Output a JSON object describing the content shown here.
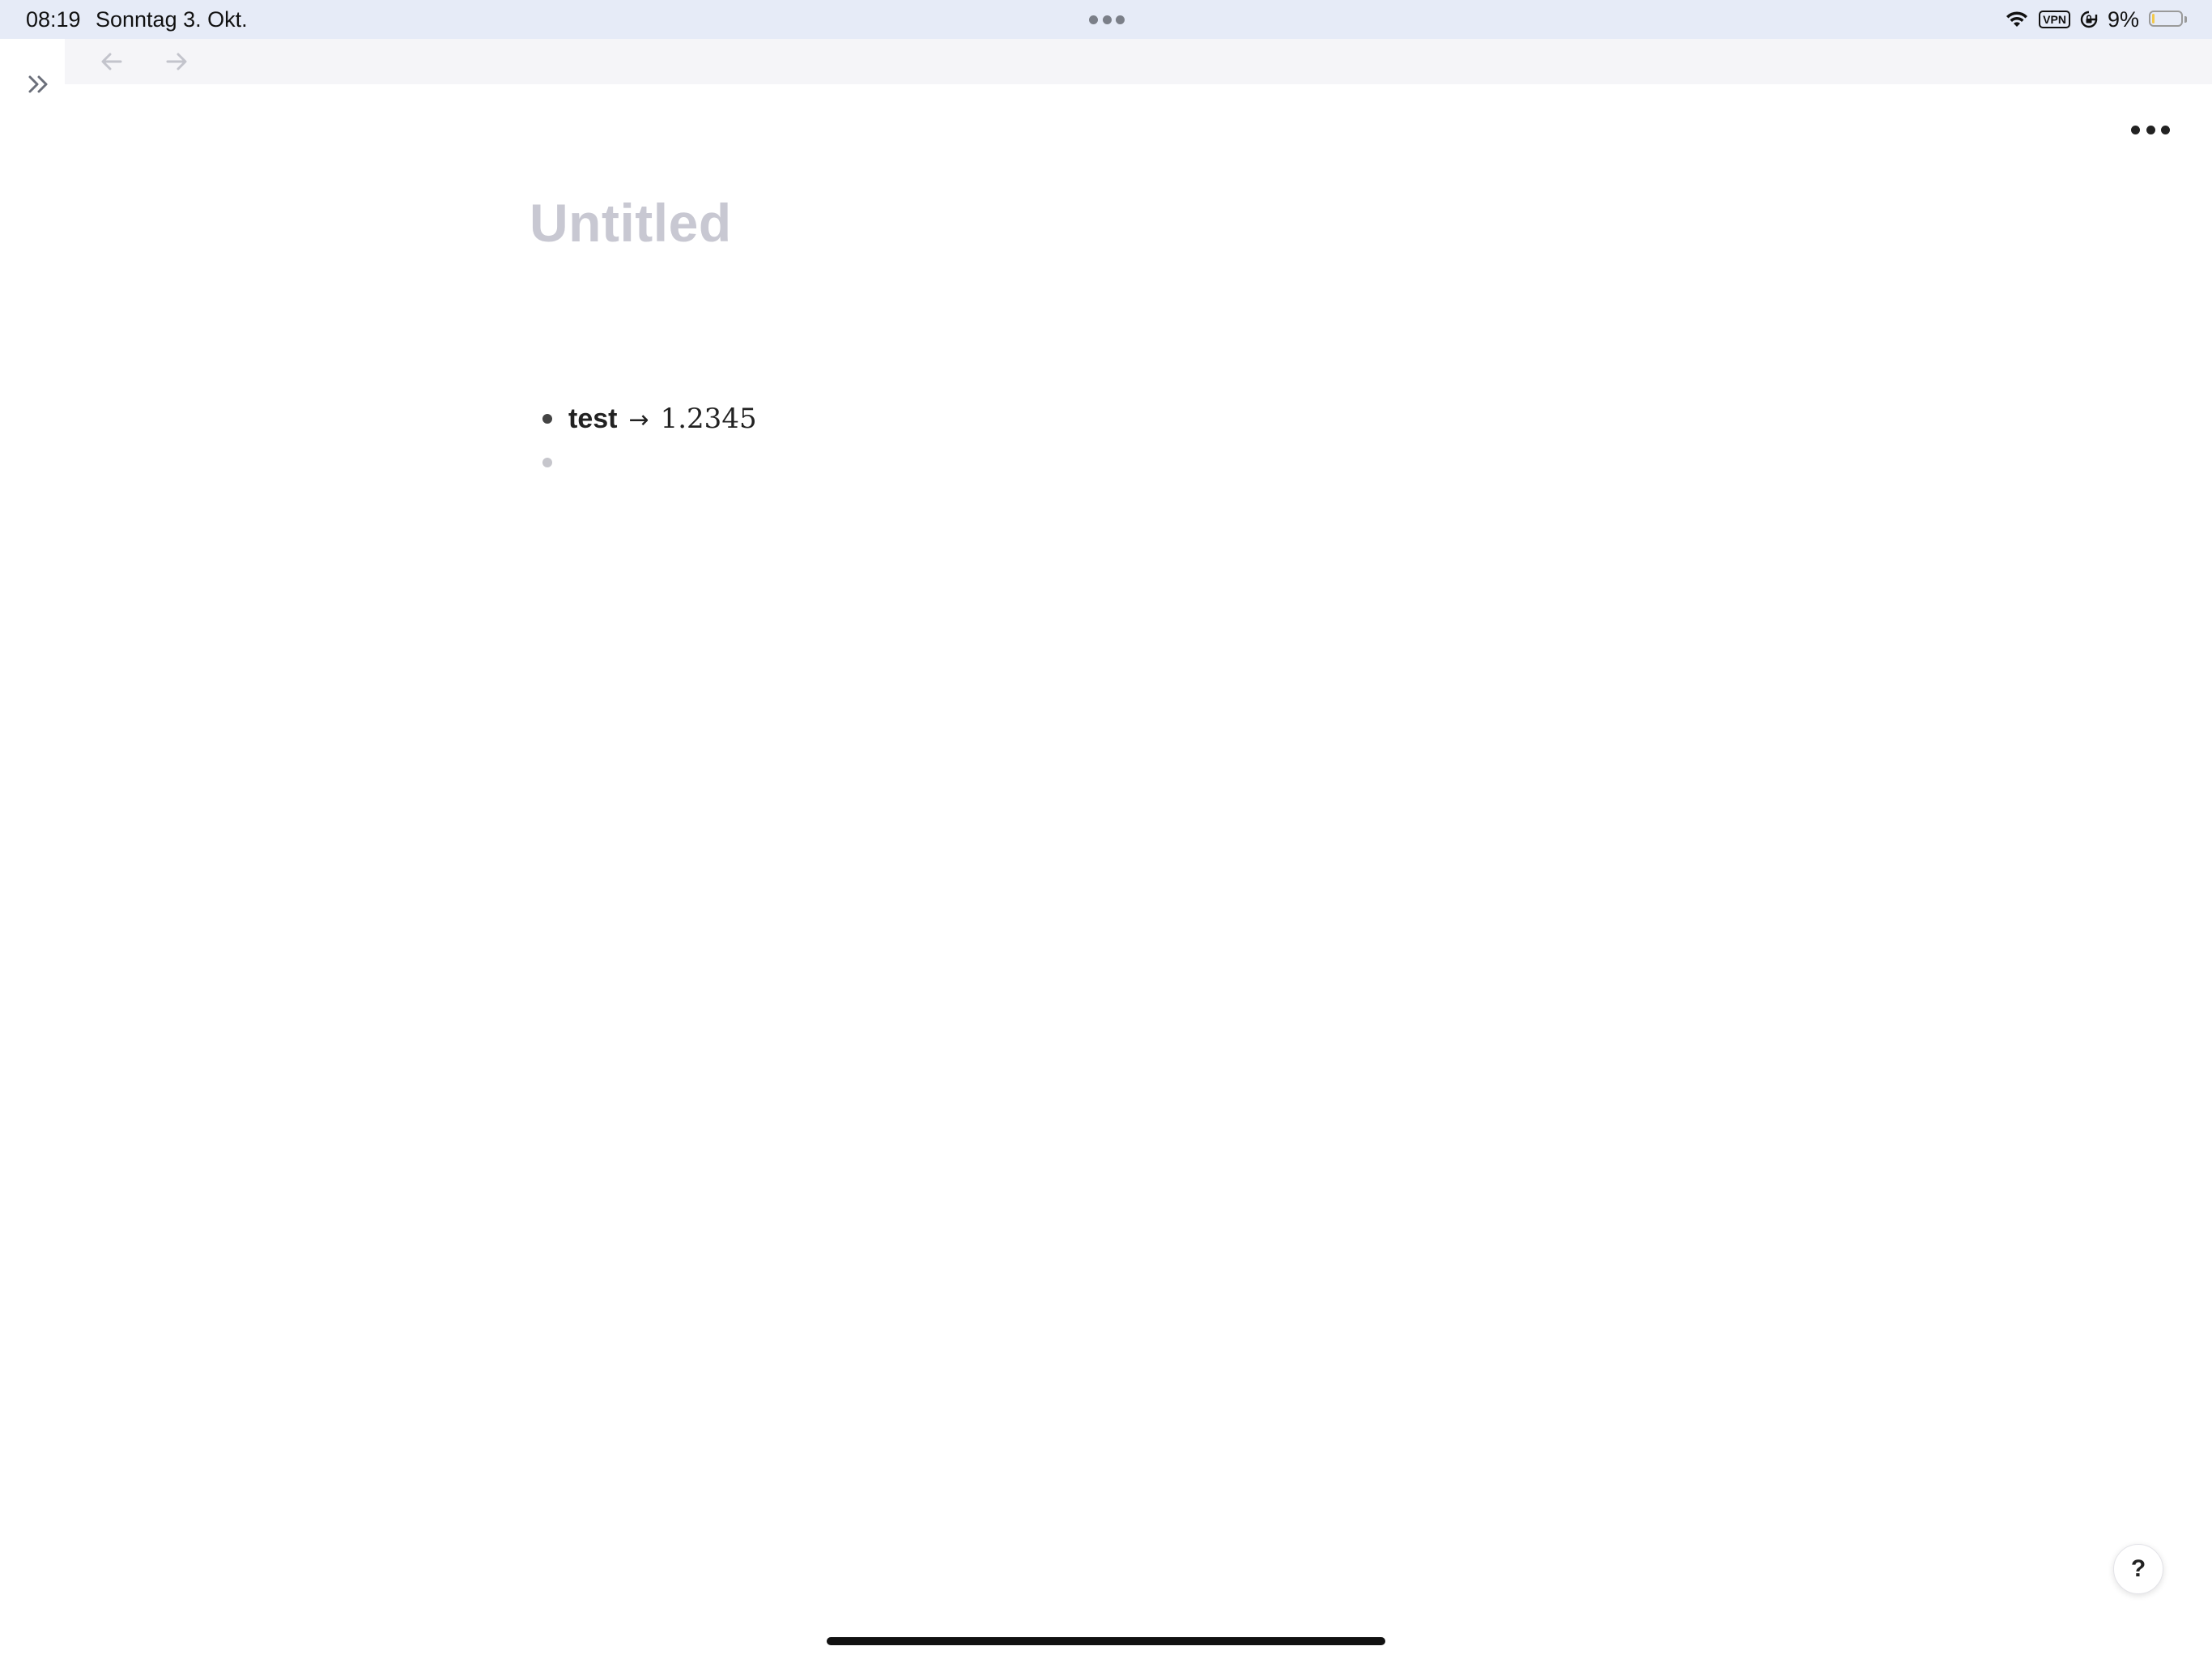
{
  "status_bar": {
    "time": "08:19",
    "date": "Sonntag 3. Okt.",
    "vpn_label": "VPN",
    "battery_percent": "9%",
    "battery_level": 0.09,
    "icons": [
      "wifi-icon",
      "vpn-badge",
      "rotation-lock-icon",
      "battery-icon"
    ]
  },
  "sidebar": {
    "toggle_icon": "double-chevron-right-icon"
  },
  "toolbar": {
    "back_icon": "arrow-left-icon",
    "forward_icon": "arrow-right-icon",
    "more_icon": "ellipsis-icon"
  },
  "document": {
    "title_placeholder": "Untitled",
    "bullets": [
      {
        "key": "test",
        "arrow": "→",
        "value": "1.2345"
      },
      {
        "key": "",
        "arrow": "",
        "value": ""
      }
    ]
  },
  "help": {
    "label": "?"
  },
  "colors": {
    "status_bar_bg": "#e6ebf7",
    "toolbar_bg": "#f5f5f8",
    "title_placeholder": "#c8c8d2",
    "text": "#222222",
    "battery_fill": "#f2c94c"
  }
}
